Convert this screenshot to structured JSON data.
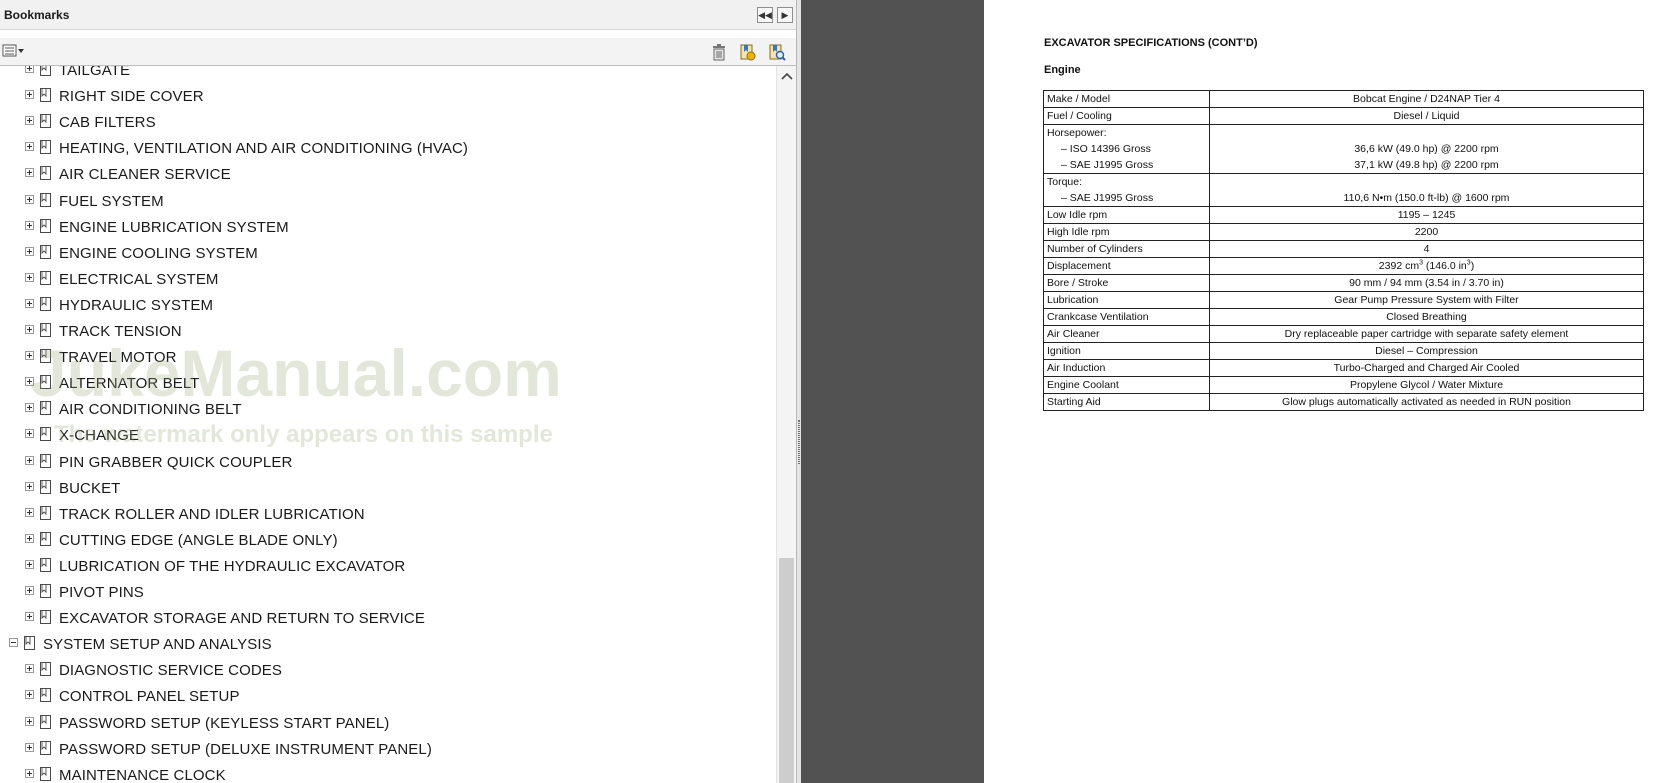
{
  "bookmarks_panel": {
    "title": "Bookmarks",
    "items": [
      {
        "label": "TAILGATE",
        "level": 1,
        "expanded": false
      },
      {
        "label": "RIGHT SIDE COVER",
        "level": 1,
        "expanded": false
      },
      {
        "label": "CAB FILTERS",
        "level": 1,
        "expanded": false
      },
      {
        "label": "HEATING, VENTILATION AND AIR CONDITIONING (HVAC)",
        "level": 1,
        "expanded": false
      },
      {
        "label": "AIR CLEANER SERVICE",
        "level": 1,
        "expanded": false
      },
      {
        "label": "FUEL SYSTEM",
        "level": 1,
        "expanded": false
      },
      {
        "label": "ENGINE LUBRICATION SYSTEM",
        "level": 1,
        "expanded": false
      },
      {
        "label": "ENGINE COOLING SYSTEM",
        "level": 1,
        "expanded": false
      },
      {
        "label": "ELECTRICAL SYSTEM",
        "level": 1,
        "expanded": false
      },
      {
        "label": "HYDRAULIC SYSTEM",
        "level": 1,
        "expanded": false
      },
      {
        "label": "TRACK TENSION",
        "level": 1,
        "expanded": false
      },
      {
        "label": "TRAVEL MOTOR",
        "level": 1,
        "expanded": false
      },
      {
        "label": "ALTERNATOR BELT",
        "level": 1,
        "expanded": false
      },
      {
        "label": "AIR CONDITIONING BELT",
        "level": 1,
        "expanded": false
      },
      {
        "label": "X-CHANGE",
        "level": 1,
        "expanded": false
      },
      {
        "label": "PIN GRABBER QUICK COUPLER",
        "level": 1,
        "expanded": false
      },
      {
        "label": "BUCKET",
        "level": 1,
        "expanded": false
      },
      {
        "label": "TRACK ROLLER AND IDLER LUBRICATION",
        "level": 1,
        "expanded": false
      },
      {
        "label": "CUTTING EDGE (ANGLE BLADE ONLY)",
        "level": 1,
        "expanded": false
      },
      {
        "label": "LUBRICATION OF THE HYDRAULIC EXCAVATOR",
        "level": 1,
        "expanded": false
      },
      {
        "label": "PIVOT PINS",
        "level": 1,
        "expanded": false
      },
      {
        "label": "EXCAVATOR STORAGE AND RETURN TO SERVICE",
        "level": 1,
        "expanded": false
      },
      {
        "label": "SYSTEM SETUP AND ANALYSIS",
        "level": 0,
        "expanded": true
      },
      {
        "label": "DIAGNOSTIC SERVICE CODES",
        "level": 1,
        "expanded": false
      },
      {
        "label": "CONTROL PANEL SETUP",
        "level": 1,
        "expanded": false
      },
      {
        "label": "PASSWORD SETUP (KEYLESS START PANEL)",
        "level": 1,
        "expanded": false
      },
      {
        "label": "PASSWORD SETUP (DELUXE INSTRUMENT PANEL)",
        "level": 1,
        "expanded": false
      },
      {
        "label": "MAINTENANCE CLOCK",
        "level": 1,
        "expanded": false
      }
    ],
    "watermark": {
      "main": "JukeManual.com",
      "sub": "The watermark only appears on this sample"
    }
  },
  "document": {
    "heading": "EXCAVATOR SPECIFICATIONS (CONT’D)",
    "subheading": "Engine",
    "specs": {
      "make_model_label": "Make / Model",
      "make_model_value": "Bobcat Engine / D24NAP Tier 4",
      "fuel_cooling_label": "Fuel / Cooling",
      "fuel_cooling_value": "Diesel / Liquid",
      "horsepower_label": "Horsepower:",
      "iso_label": "– ISO 14396 Gross",
      "iso_value": "36,6 kW (49.0 hp) @ 2200 rpm",
      "sae_hp_label": "– SAE J1995 Gross",
      "sae_hp_value": "37,1 kW (49.8 hp) @ 2200 rpm",
      "torque_label": "Torque:",
      "sae_torque_label": "– SAE J1995 Gross",
      "sae_torque_value": "110,6 N•m (150.0 ft-lb) @ 1600 rpm",
      "low_idle_label": "Low Idle rpm",
      "low_idle_value": "1195 – 1245",
      "high_idle_label": "High Idle rpm",
      "high_idle_value": "2200",
      "cylinders_label": "Number of Cylinders",
      "cylinders_value": "4",
      "displacement_label": "Displacement",
      "displacement_metric": "2392 cm",
      "displacement_imperial": "(146.0 in",
      "displacement_exp": "3",
      "displacement_close": ")",
      "bore_label": "Bore / Stroke",
      "bore_value": "90 mm / 94 mm (3.54 in / 3.70 in)",
      "lubrication_label": "Lubrication",
      "lubrication_value": "Gear Pump Pressure System with Filter",
      "crankcase_label": "Crankcase Ventilation",
      "crankcase_value": "Closed Breathing",
      "air_cleaner_label": "Air Cleaner",
      "air_cleaner_value": "Dry replaceable paper cartridge with separate safety element",
      "ignition_label": "Ignition",
      "ignition_value": "Diesel – Compression",
      "air_induction_label": "Air Induction",
      "air_induction_value": "Turbo-Charged and Charged Air Cooled",
      "coolant_label": "Engine Coolant",
      "coolant_value": "Propylene Glycol / Water Mixture",
      "starting_label": "Starting Aid",
      "starting_value": "Glow plugs automatically activated as needed in RUN position"
    }
  },
  "colors": {
    "viewer_background": "#525252",
    "panel_background": "#ffffff",
    "watermark": "#96aa78"
  }
}
